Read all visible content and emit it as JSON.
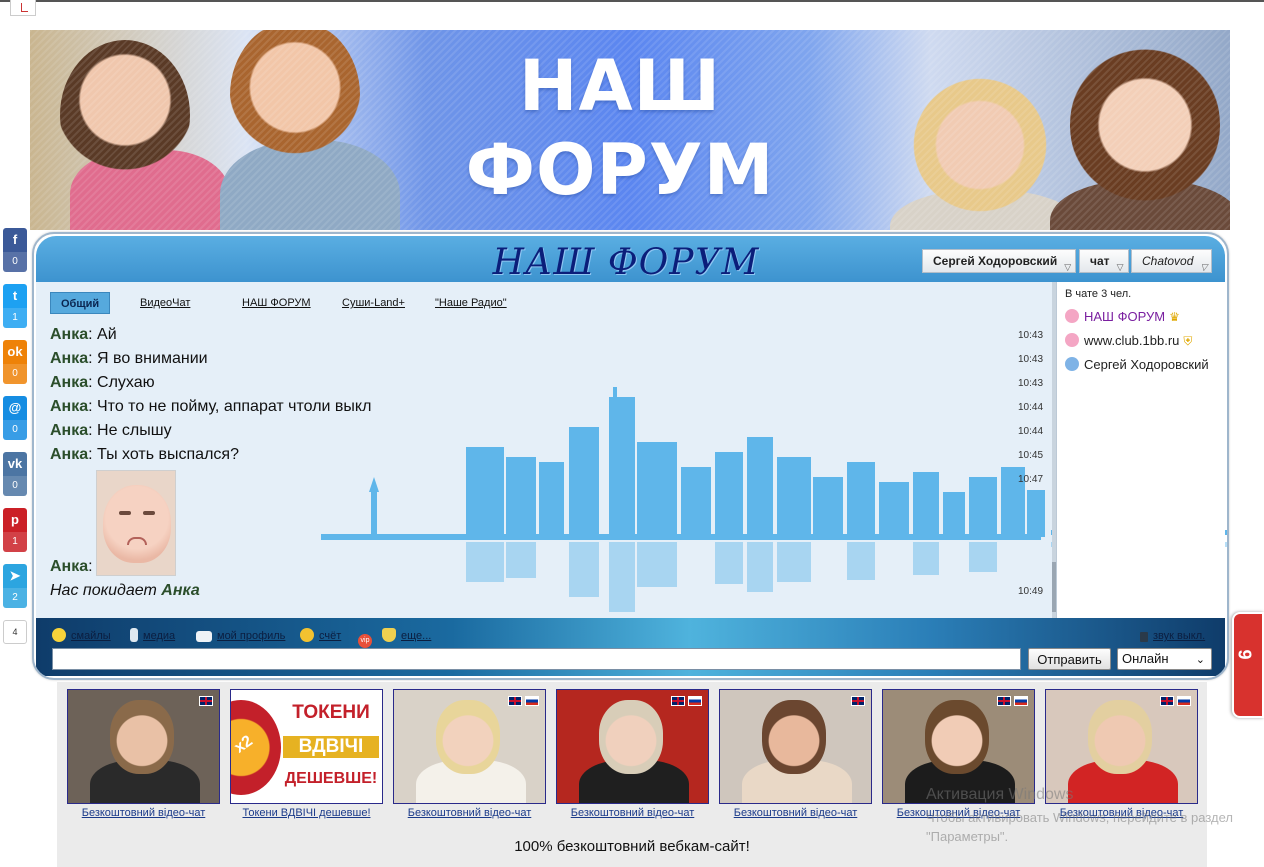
{
  "banner": {
    "title_line1": "НАШ",
    "title_line2": "ФОРУМ"
  },
  "social": [
    {
      "name": "facebook",
      "glyph": "f",
      "count": "0",
      "color": "#3b5998"
    },
    {
      "name": "twitter",
      "glyph": "t",
      "count": "1",
      "color": "#1da1f2"
    },
    {
      "name": "odnoklassniki",
      "glyph": "ok",
      "count": "0",
      "color": "#ee8208"
    },
    {
      "name": "moimir",
      "glyph": "@",
      "count": "0",
      "color": "#168de2"
    },
    {
      "name": "vkontakte",
      "glyph": "vk",
      "count": "0",
      "color": "#4c75a3"
    },
    {
      "name": "pinterest",
      "glyph": "p",
      "count": "1",
      "color": "#cb2027"
    },
    {
      "name": "telegram",
      "glyph": "➤",
      "count": "2",
      "color": "#2ca5e0"
    }
  ],
  "social_total": "4",
  "chat": {
    "title": "НАШ ФОРУМ",
    "user_button": "Сергей Ходоровский",
    "chat_button": "чат",
    "brand_button": "Chatovod",
    "tabs": [
      "Общий",
      "ВидеоЧат",
      "НАШ ФОРУМ",
      "Суши-Land+",
      "\"Наше Радио\""
    ],
    "messages": [
      {
        "nick": "Анка",
        "text": ": Ай",
        "time": "10:43"
      },
      {
        "nick": "Анка",
        "text": ": Я во внимании",
        "time": "10:43"
      },
      {
        "nick": "Анка",
        "text": ": Слухаю",
        "time": "10:43"
      },
      {
        "nick": "Анка",
        "text": ": Что то не пойму, аппарат чтоли выкл",
        "time": "10:44"
      },
      {
        "nick": "Анка",
        "text": ": Не слышу",
        "time": "10:44"
      },
      {
        "nick": "Анка",
        "text": ": Ты хоть выспался?",
        "time": "10:45"
      }
    ],
    "image_message": {
      "nick": "Анка",
      "text": ":",
      "time": "10:47"
    },
    "leave_message": {
      "prefix": "Нас покидает ",
      "nick": "Анка",
      "time": "10:49"
    },
    "users_count": "В чате 3 чел.",
    "users": [
      {
        "name": "НАШ ФОРУМ",
        "badge": "♛",
        "color": "#7a1fa0",
        "ava": "#f4a6c4"
      },
      {
        "name": "www.club.1bb.ru",
        "badge": "⛨",
        "color": "#222222",
        "ava": "#f4a6c4"
      },
      {
        "name": "Сергей Ходоровский",
        "badge": "",
        "color": "#222222",
        "ava": "#7fb3e6"
      }
    ],
    "toolbar": {
      "smileys": "смайлы",
      "media": "медиа",
      "profile": "мой профиль",
      "account": "счёт",
      "vip": "vip",
      "more": "еще...",
      "sound": "звук выкл."
    },
    "input_placeholder": "",
    "send_label": "Отправить",
    "status_value": "Онлайн"
  },
  "red_tab": "9",
  "cams": [
    {
      "caption": "Безкоштовний відео-чат",
      "flags": [
        "uk"
      ],
      "bg": "#6d6258",
      "skin": "#e9c1a6",
      "hair": "#8a6a4a",
      "cloth": "#2a2a2a"
    },
    {
      "caption": "Токени ВДВІЧІ дешевше!",
      "promo": true,
      "promo_lines": [
        "ТОКЕНИ",
        "ВДВІЧІ",
        "ДЕШЕВШЕ!"
      ],
      "x2": "x2"
    },
    {
      "caption": "Безкоштовний відео-чат",
      "flags": [
        "uk",
        "ru"
      ],
      "bg": "#d9d2c8",
      "skin": "#f2d2bd",
      "hair": "#e8d59a",
      "cloth": "#f4f1ea"
    },
    {
      "caption": "Безкоштовний відео-чат",
      "flags": [
        "uk",
        "ru"
      ],
      "bg": "#b5271f",
      "skin": "#f0d0bd",
      "hair": "#d8cdb8",
      "cloth": "#1f1f1f"
    },
    {
      "caption": "Безкоштовний відео-чат",
      "flags": [
        "uk"
      ],
      "bg": "#cfc6bd",
      "skin": "#e8b89c",
      "hair": "#6b4630",
      "cloth": "#e9d8c6"
    },
    {
      "caption": "Безкоштовний відео-чат",
      "flags": [
        "uk",
        "ru"
      ],
      "bg": "#9c8c78",
      "skin": "#f1ccb6",
      "hair": "#6b4a2e",
      "cloth": "#1c1c1c"
    },
    {
      "caption": "Безкоштовний відео-чат",
      "flags": [
        "uk",
        "ru"
      ],
      "bg": "#d8c8bc",
      "skin": "#efc9b2",
      "hair": "#e3cfa0",
      "cloth": "#d22424"
    }
  ],
  "bottom_text": "100% безкоштовний вебкам-сайт!",
  "watermark": {
    "line1": "Активация Windows",
    "line2": "Чтобы активировать Windows, перейдите в раздел \"Параметры\"."
  }
}
